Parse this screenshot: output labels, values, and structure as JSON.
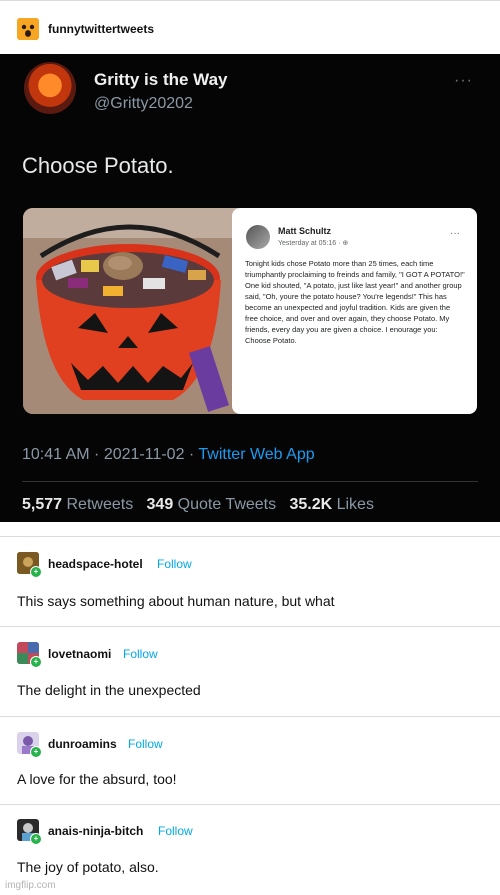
{
  "op": {
    "username": "funnytwittertweets"
  },
  "tweet": {
    "display_name": "Gritty is the Way",
    "handle": "@Gritty20202",
    "more": "···",
    "text": "Choose Potato.",
    "timestamp": "10:41 AM · 2021-11-02 · ",
    "app": "Twitter Web App",
    "stats": {
      "retweets_count": "5,577",
      "retweets_label": " Retweets  ",
      "quotes_count": "349",
      "quotes_label": " Quote Tweets  ",
      "likes_count": "35.2K",
      "likes_label": " Likes"
    },
    "embedded_post": {
      "author": "Matt Schultz",
      "time": "Yesterday at 05:16 · ⊕",
      "more": "···",
      "body": "Tonight kids chose Potato more than 25 times, each time triumphantly proclaiming to freinds and family, \"I GOT A POTATO!\" One kid shouted, \"A potato, just like last year!\" and another group said, \"Oh, youre the potato house? You're legends!\" This has become an unexpected and joyful tradition. Kids are given the free choice, and over and over again, they choose Potato. My friends, every day you are given a choice. I enourage you: Choose Potato."
    }
  },
  "replies": [
    {
      "username": "headspace-hotel",
      "follow": "Follow",
      "text": "This says something about human nature, but what"
    },
    {
      "username": "lovetnaomi",
      "follow": "Follow",
      "text": "The delight in the unexpected"
    },
    {
      "username": "dunroamins",
      "follow": "Follow",
      "text": "A love for the absurd, too!"
    },
    {
      "username": "anais-ninja-bitch",
      "follow": "Follow",
      "text": "The joy of potato, also."
    }
  ],
  "watermark": "imgflip.com"
}
